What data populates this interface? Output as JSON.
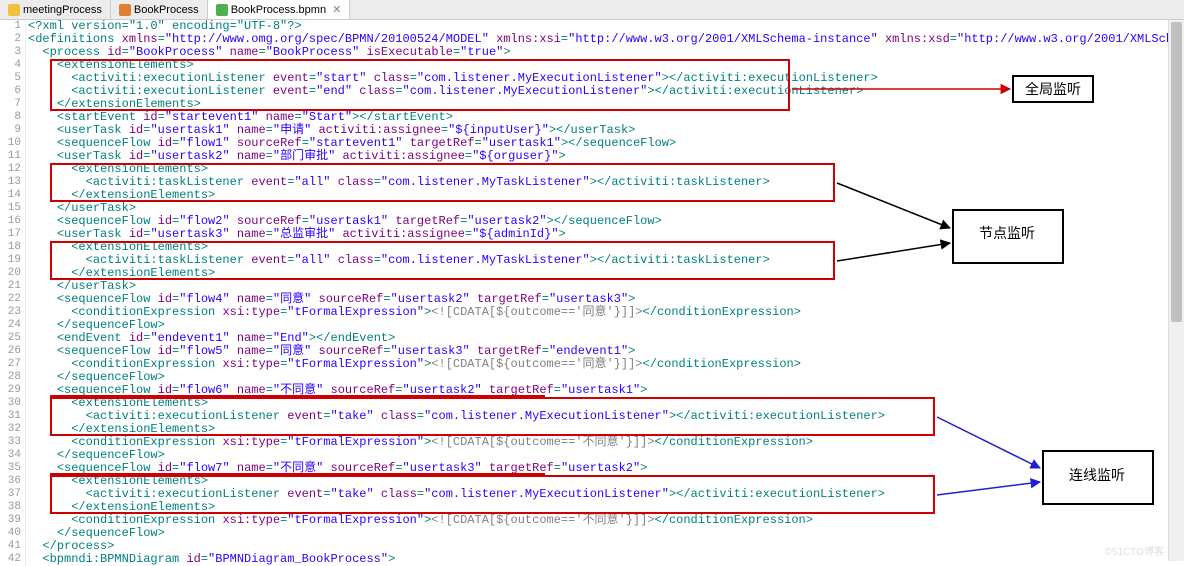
{
  "tabs": [
    {
      "label": "meetingProcess",
      "iconClass": "icon-yellow",
      "active": false
    },
    {
      "label": "BookProcess",
      "iconClass": "icon-orange",
      "active": false
    },
    {
      "label": "BookProcess.bpmn",
      "iconClass": "icon-green",
      "active": true,
      "closable": true
    }
  ],
  "annotations": {
    "global": "全局监听",
    "node": "节点监听",
    "flow": "连线监听"
  },
  "watermark": "©51CTO博客",
  "code_lines": [
    "<?xml version=\"1.0\" encoding=\"UTF-8\"?>",
    "<definitions xmlns=\"http://www.omg.org/spec/BPMN/20100524/MODEL\" xmlns:xsi=\"http://www.w3.org/2001/XMLSchema-instance\" xmlns:xsd=\"http://www.w3.org/2001/XMLSchema\" xmlns:activiti=\"http://activiti.",
    "  <process id=\"BookProcess\" name=\"BookProcess\" isExecutable=\"true\">",
    "    <extensionElements>",
    "      <activiti:executionListener event=\"start\" class=\"com.listener.MyExecutionListener\"></activiti:executionListener>",
    "      <activiti:executionListener event=\"end\" class=\"com.listener.MyExecutionListener\"></activiti:executionListener>",
    "    </extensionElements>",
    "    <startEvent id=\"startevent1\" name=\"Start\"></startEvent>",
    "    <userTask id=\"usertask1\" name=\"申请\" activiti:assignee=\"${inputUser}\"></userTask>",
    "    <sequenceFlow id=\"flow1\" sourceRef=\"startevent1\" targetRef=\"usertask1\"></sequenceFlow>",
    "    <userTask id=\"usertask2\" name=\"部门审批\" activiti:assignee=\"${orguser}\">",
    "      <extensionElements>",
    "        <activiti:taskListener event=\"all\" class=\"com.listener.MyTaskListener\"></activiti:taskListener>",
    "      </extensionElements>",
    "    </userTask>",
    "    <sequenceFlow id=\"flow2\" sourceRef=\"usertask1\" targetRef=\"usertask2\"></sequenceFlow>",
    "    <userTask id=\"usertask3\" name=\"总监审批\" activiti:assignee=\"${adminId}\">",
    "      <extensionElements>",
    "        <activiti:taskListener event=\"all\" class=\"com.listener.MyTaskListener\"></activiti:taskListener>",
    "      </extensionElements>",
    "    </userTask>",
    "    <sequenceFlow id=\"flow4\" name=\"同意\" sourceRef=\"usertask2\" targetRef=\"usertask3\">",
    "      <conditionExpression xsi:type=\"tFormalExpression\"><![CDATA[${outcome=='同意'}]]></conditionExpression>",
    "    </sequenceFlow>",
    "    <endEvent id=\"endevent1\" name=\"End\"></endEvent>",
    "    <sequenceFlow id=\"flow5\" name=\"同意\" sourceRef=\"usertask3\" targetRef=\"endevent1\">",
    "      <conditionExpression xsi:type=\"tFormalExpression\"><![CDATA[${outcome=='同意'}]]></conditionExpression>",
    "    </sequenceFlow>",
    "    <sequenceFlow id=\"flow6\" name=\"不同意\" sourceRef=\"usertask2\" targetRef=\"usertask1\">",
    "      <extensionElements>",
    "        <activiti:executionListener event=\"take\" class=\"com.listener.MyExecutionListener\"></activiti:executionListener>",
    "      </extensionElements>",
    "      <conditionExpression xsi:type=\"tFormalExpression\"><![CDATA[${outcome=='不同意'}]]></conditionExpression>",
    "    </sequenceFlow>",
    "    <sequenceFlow id=\"flow7\" name=\"不同意\" sourceRef=\"usertask3\" targetRef=\"usertask2\">",
    "      <extensionElements>",
    "        <activiti:executionListener event=\"take\" class=\"com.listener.MyExecutionListener\"></activiti:executionListener>",
    "      </extensionElements>",
    "      <conditionExpression xsi:type=\"tFormalExpression\"><![CDATA[${outcome=='不同意'}]]></conditionExpression>",
    "    </sequenceFlow>",
    "  </process>",
    "  <bpmndi:BPMNDiagram id=\"BPMNDiagram_BookProcess\">"
  ]
}
